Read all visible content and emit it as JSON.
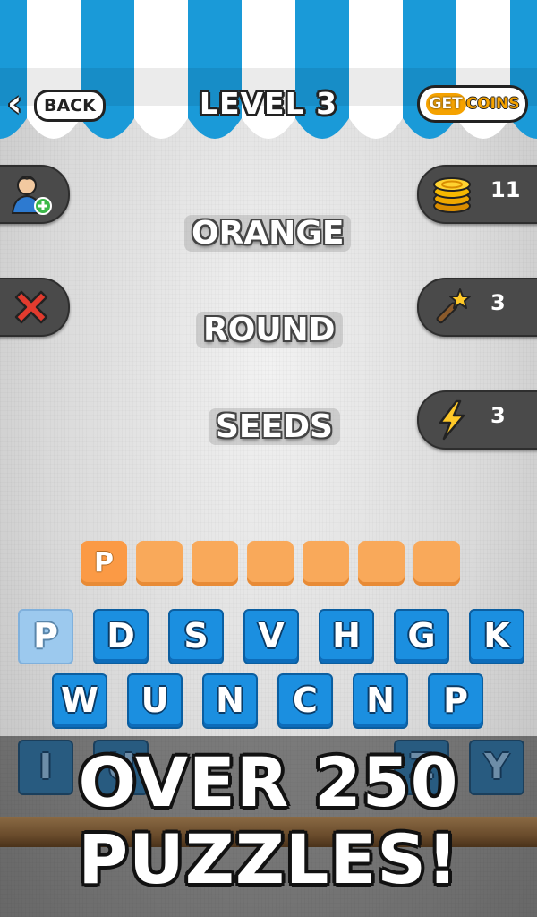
{
  "header": {
    "back_label": "BACK",
    "back_icon": "chevron-left-icon",
    "level_title": "LEVEL 3",
    "get_label": "GET",
    "coins_label": "COINS"
  },
  "stats": {
    "coins": "11",
    "magic_wand": "3",
    "lightning": "3"
  },
  "clues": [
    "ORANGE",
    "ROUND",
    "SEEDS"
  ],
  "answer": {
    "length": 7,
    "letters": [
      "P",
      "",
      "",
      "",
      "",
      "",
      ""
    ]
  },
  "keyboard": {
    "row1": [
      "P",
      "D",
      "S",
      "V",
      "H",
      "G",
      "K"
    ],
    "row2": [
      "W",
      "U",
      "N",
      "C",
      "N",
      "P"
    ],
    "row3": [
      "I",
      "U",
      "",
      "",
      "",
      "Z",
      "Y"
    ]
  },
  "promo": {
    "line1": "OVER 250",
    "line2": "PUZZLES!"
  },
  "colors": {
    "awning_blue": "#1a9ad8",
    "key_blue": "#1b8fe0",
    "answer_orange": "#f9a95a",
    "tab_gray": "#4a4a4a"
  }
}
